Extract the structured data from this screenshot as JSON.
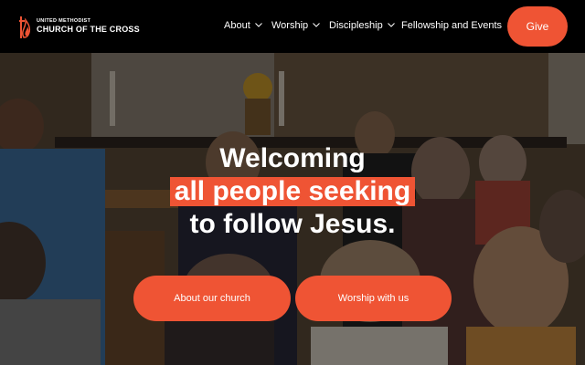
{
  "header": {
    "logo_small": "UNITED METHODIST",
    "logo_big": "CHURCH OF THE CROSS",
    "nav": [
      {
        "label": "About",
        "has_dropdown": true
      },
      {
        "label": "Worship",
        "has_dropdown": true
      },
      {
        "label": "Discipleship",
        "has_dropdown": true
      },
      {
        "label": "Fellowship and Events",
        "has_dropdown": false
      }
    ],
    "give_label": "Give"
  },
  "hero": {
    "line1": "Welcoming",
    "line2": "all people seeking",
    "line3": "to follow Jesus.",
    "cta_about": "About our church",
    "cta_worship": "Worship with us"
  },
  "colors": {
    "accent": "#ef5434",
    "header_bg": "#000000",
    "text": "#ffffff"
  },
  "icons": [
    "cross-flame-logo-icon",
    "chevron-down-icon"
  ]
}
